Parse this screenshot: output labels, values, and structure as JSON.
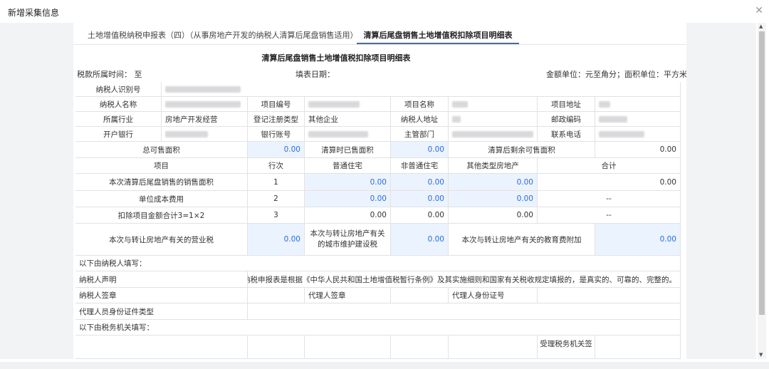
{
  "dialog": {
    "title": "新增采集信息"
  },
  "tabs": [
    {
      "label": "土地增值税纳税申报表（四）（从事房地产开发的纳税人清算后尾盘销售适用）"
    },
    {
      "label": "清算后尾盘销售土地增值税扣除项目明细表"
    }
  ],
  "form": {
    "title": "清算后尾盘销售土地增值税扣除项目明细表",
    "tax_period_label": "税款所属时间：",
    "tax_period_to": "至",
    "fill_date_label": "填表日期：",
    "unit_note": "金额单位：元至角分；面积单位：平方米"
  },
  "info": {
    "taxpayer_id_label": "纳税人识别号",
    "taxpayer_name_label": "纳税人名称",
    "project_no_label": "项目编号",
    "project_name_label": "项目名称",
    "project_addr_label": "项目地址",
    "industry_label": "所属行业",
    "industry_value": "房地产开发经营",
    "reg_type_label": "登记注册类型",
    "reg_type_value": "其他企业",
    "taxpayer_addr_label": "纳税人地址",
    "postcode_label": "邮政编码",
    "bank_label": "开户银行",
    "account_label": "银行账号",
    "authority_label": "主管部门",
    "phone_label": "联系电话"
  },
  "area": {
    "total_label": "总可售面积",
    "total_value": "0.00",
    "sold_label": "清算时已售面积",
    "sold_value": "0.00",
    "remain_label": "清算后剩余可售面积",
    "remain_value": "0.00"
  },
  "table": {
    "headers": [
      "项目",
      "行次",
      "普通住宅",
      "非普通住宅",
      "其他类型房地产",
      "合计"
    ],
    "rows": [
      {
        "item": "本次清算后尾盘销售的销售面积",
        "line": "1",
        "c1": "0.00",
        "c2": "0.00",
        "c3": "0.00",
        "total": "0.00"
      },
      {
        "item": "单位成本费用",
        "line": "2",
        "c1": "0.00",
        "c2": "0.00",
        "c3": "0.00",
        "total": "--"
      },
      {
        "item": "扣除项目金额合计3=1×2",
        "line": "3",
        "c1": "0.00",
        "c2": "0.00",
        "c3": "0.00",
        "total": "--"
      }
    ]
  },
  "taxes": {
    "business_tax_label": "本次与转让房地产有关的营业税",
    "business_tax_value": "0.00",
    "urban_tax_label": "本次与转让房地产有关的城市维护建设税",
    "urban_tax_value": "0.00",
    "edu_tax_label": "本次与转让房地产有关的教育费附加",
    "edu_tax_value": "0.00"
  },
  "taxpayer_section": {
    "header": "以下由纳税人填写：",
    "declaration_label": "纳税人声明",
    "declaration_text": "此纳税申报表是根据《中华人民共和国土地增值税暂行条例》及其实施细则和国家有关税收规定填报的，是真实的、可靠的、完整的。",
    "sign_label": "纳税人签章",
    "agent_sign_label": "代理人签章",
    "agent_id_label": "代理人身份证号",
    "agent_id_type_label": "代理人员身份证件类型"
  },
  "tax_authority_section": {
    "header": "以下由税务机关填写：",
    "receiving_label": "受理税务机关签"
  }
}
